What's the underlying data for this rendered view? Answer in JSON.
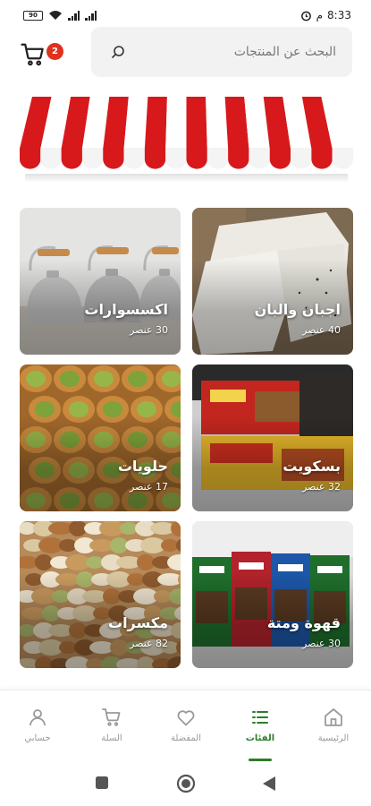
{
  "status_bar": {
    "battery": "90",
    "time": "8:33",
    "time_suffix": "م"
  },
  "header": {
    "cart_count": "2",
    "search_placeholder": "البحث عن المنتجات"
  },
  "categories": [
    {
      "name": "اجبان والبان",
      "count": "40 عنصر"
    },
    {
      "name": "اكسسوارات",
      "count": "30 عنصر"
    },
    {
      "name": "بسكويت",
      "count": "32 عنصر"
    },
    {
      "name": "حلويات",
      "count": "17 عنصر"
    },
    {
      "name": "قهوة ومتة",
      "count": "30 عنصر"
    },
    {
      "name": "مكسرات",
      "count": "82 عنصر"
    }
  ],
  "bottom_nav": {
    "items": [
      {
        "label": "الرئيسية",
        "icon": "home-icon"
      },
      {
        "label": "الفئات",
        "icon": "categories-icon",
        "active": true
      },
      {
        "label": "المفضلة",
        "icon": "heart-icon"
      },
      {
        "label": "السلة",
        "icon": "cart-icon"
      },
      {
        "label": "حسابي",
        "icon": "user-icon"
      }
    ]
  },
  "colors": {
    "accent": "#2d7d2a",
    "badge": "#e0301e",
    "awning_red": "#d7191c"
  }
}
